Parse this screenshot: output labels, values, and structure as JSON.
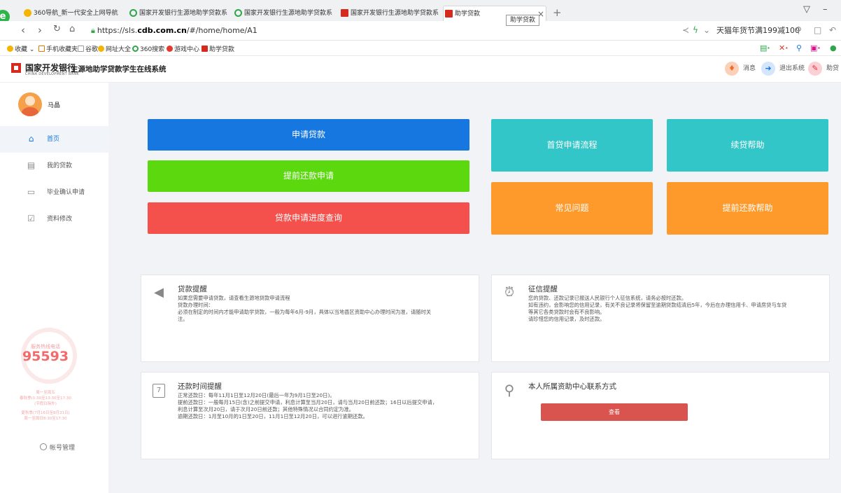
{
  "browser": {
    "tabs": [
      {
        "title": "360导航_新一代安全上网导航",
        "icon_color": "#f5b400"
      },
      {
        "title": "国家开发银行生源地助学贷款系",
        "icon_color": "#2fa64c"
      },
      {
        "title": "国家开发银行生源地助学贷款系",
        "icon_color": "#2fa64c"
      },
      {
        "title": "国家开发银行生源地助学贷款系",
        "icon_color": "#d72a1f"
      },
      {
        "title": "助学贷款",
        "icon_color": "#d72a1f"
      }
    ],
    "tab_tooltip": "助学贷款",
    "url_prefix": "https://sls.",
    "url_domain": "cdb.com.cn",
    "url_path": "/#/home/home/A1",
    "search_box_text": "天猫年货节满199减100",
    "bookmarks": [
      "收藏",
      "手机收藏夹",
      "谷歌",
      "网址大全",
      "360搜索",
      "游戏中心",
      "助学贷款"
    ]
  },
  "header": {
    "bank_name": "国家开发银行",
    "bank_name_en": "CHINA DEVELOPMENT BANK",
    "system_name": "生源地助学贷款学生在线系统",
    "messages_label": "消息",
    "logout_label": "退出系统",
    "help_label": "助贷"
  },
  "sidebar": {
    "user_name": "马晶",
    "menu": [
      {
        "label": "首页",
        "icon": "home-icon"
      },
      {
        "label": "我的贷款",
        "icon": "document-icon"
      },
      {
        "label": "毕业确认申请",
        "icon": "monitor-icon"
      },
      {
        "label": "资料修改",
        "icon": "edit-icon"
      }
    ],
    "hotline_title": "服务热线电话",
    "hotline_number": "95593",
    "hotline_lines": [
      "周一至周五",
      "春秋季(1:30至13:30至17:30",
      "(节假日除外)",
      "夏秋季(7月16日至8月31日)",
      "周一至周日8:30至17:30"
    ],
    "account_mgmt": "帐号管理"
  },
  "main": {
    "actions": {
      "apply_loan": "申请贷款",
      "early_repay_apply": "提前还款申请",
      "progress_query": "贷款申请进度查询"
    },
    "quick_links": {
      "first_loan_process": "首贷申请流程",
      "renewal_help": "续贷帮助",
      "faq": "常见问题",
      "early_repay_help": "提前还款帮助"
    },
    "loan_reminder": {
      "title": "贷款提醒",
      "lines": [
        "如果您需要申请贷款，请查看生源地贷款申请流程",
        "贷款办理时间：",
        "必须在制定的时间内才能申请助学贷款，一般为每年6月-9月，具体以当地县区资助中心办理时间为准，请随时关",
        "注。"
      ]
    },
    "credit_reminder": {
      "title": "征信提醒",
      "lines": [
        "您的贷款、还款记录已报送人民银行个人征信系统，请务必按时还款。",
        "如有违约，会影响您的信用记录，有关不良记录将保留至逾期贷款结清后5年，今后在办理信用卡、申请房贷与车贷",
        "等其它各类贷款时会有不良影响。",
        "请珍惜您的信用记录，及时还款。"
      ]
    },
    "repay_reminder": {
      "title": "还款时间提醒",
      "lines": [
        "正常还款日：每年11月1日至12月20日(最后一年为9月1日至20日)。",
        "提前还款日：一般每月15日(含)之前提交申请，利息计算至当月20日，请与当月20日前还款；16日以后提交申请，",
        "利息计算至次月20日，请于次月20日前还款；其他特殊情况以合同约定为准。",
        "逾期还款日：1月至10月的1日至20日，11月1日至12月20日，可以进行逾期还款。"
      ]
    },
    "contact": {
      "title": "本人所属资助中心联系方式",
      "button_label": "查看"
    }
  },
  "colors": {
    "blue": "#1677e0",
    "green": "#5bd90e",
    "red": "#f4504c",
    "teal": "#33c6c8",
    "orange": "#fe9a2b"
  }
}
